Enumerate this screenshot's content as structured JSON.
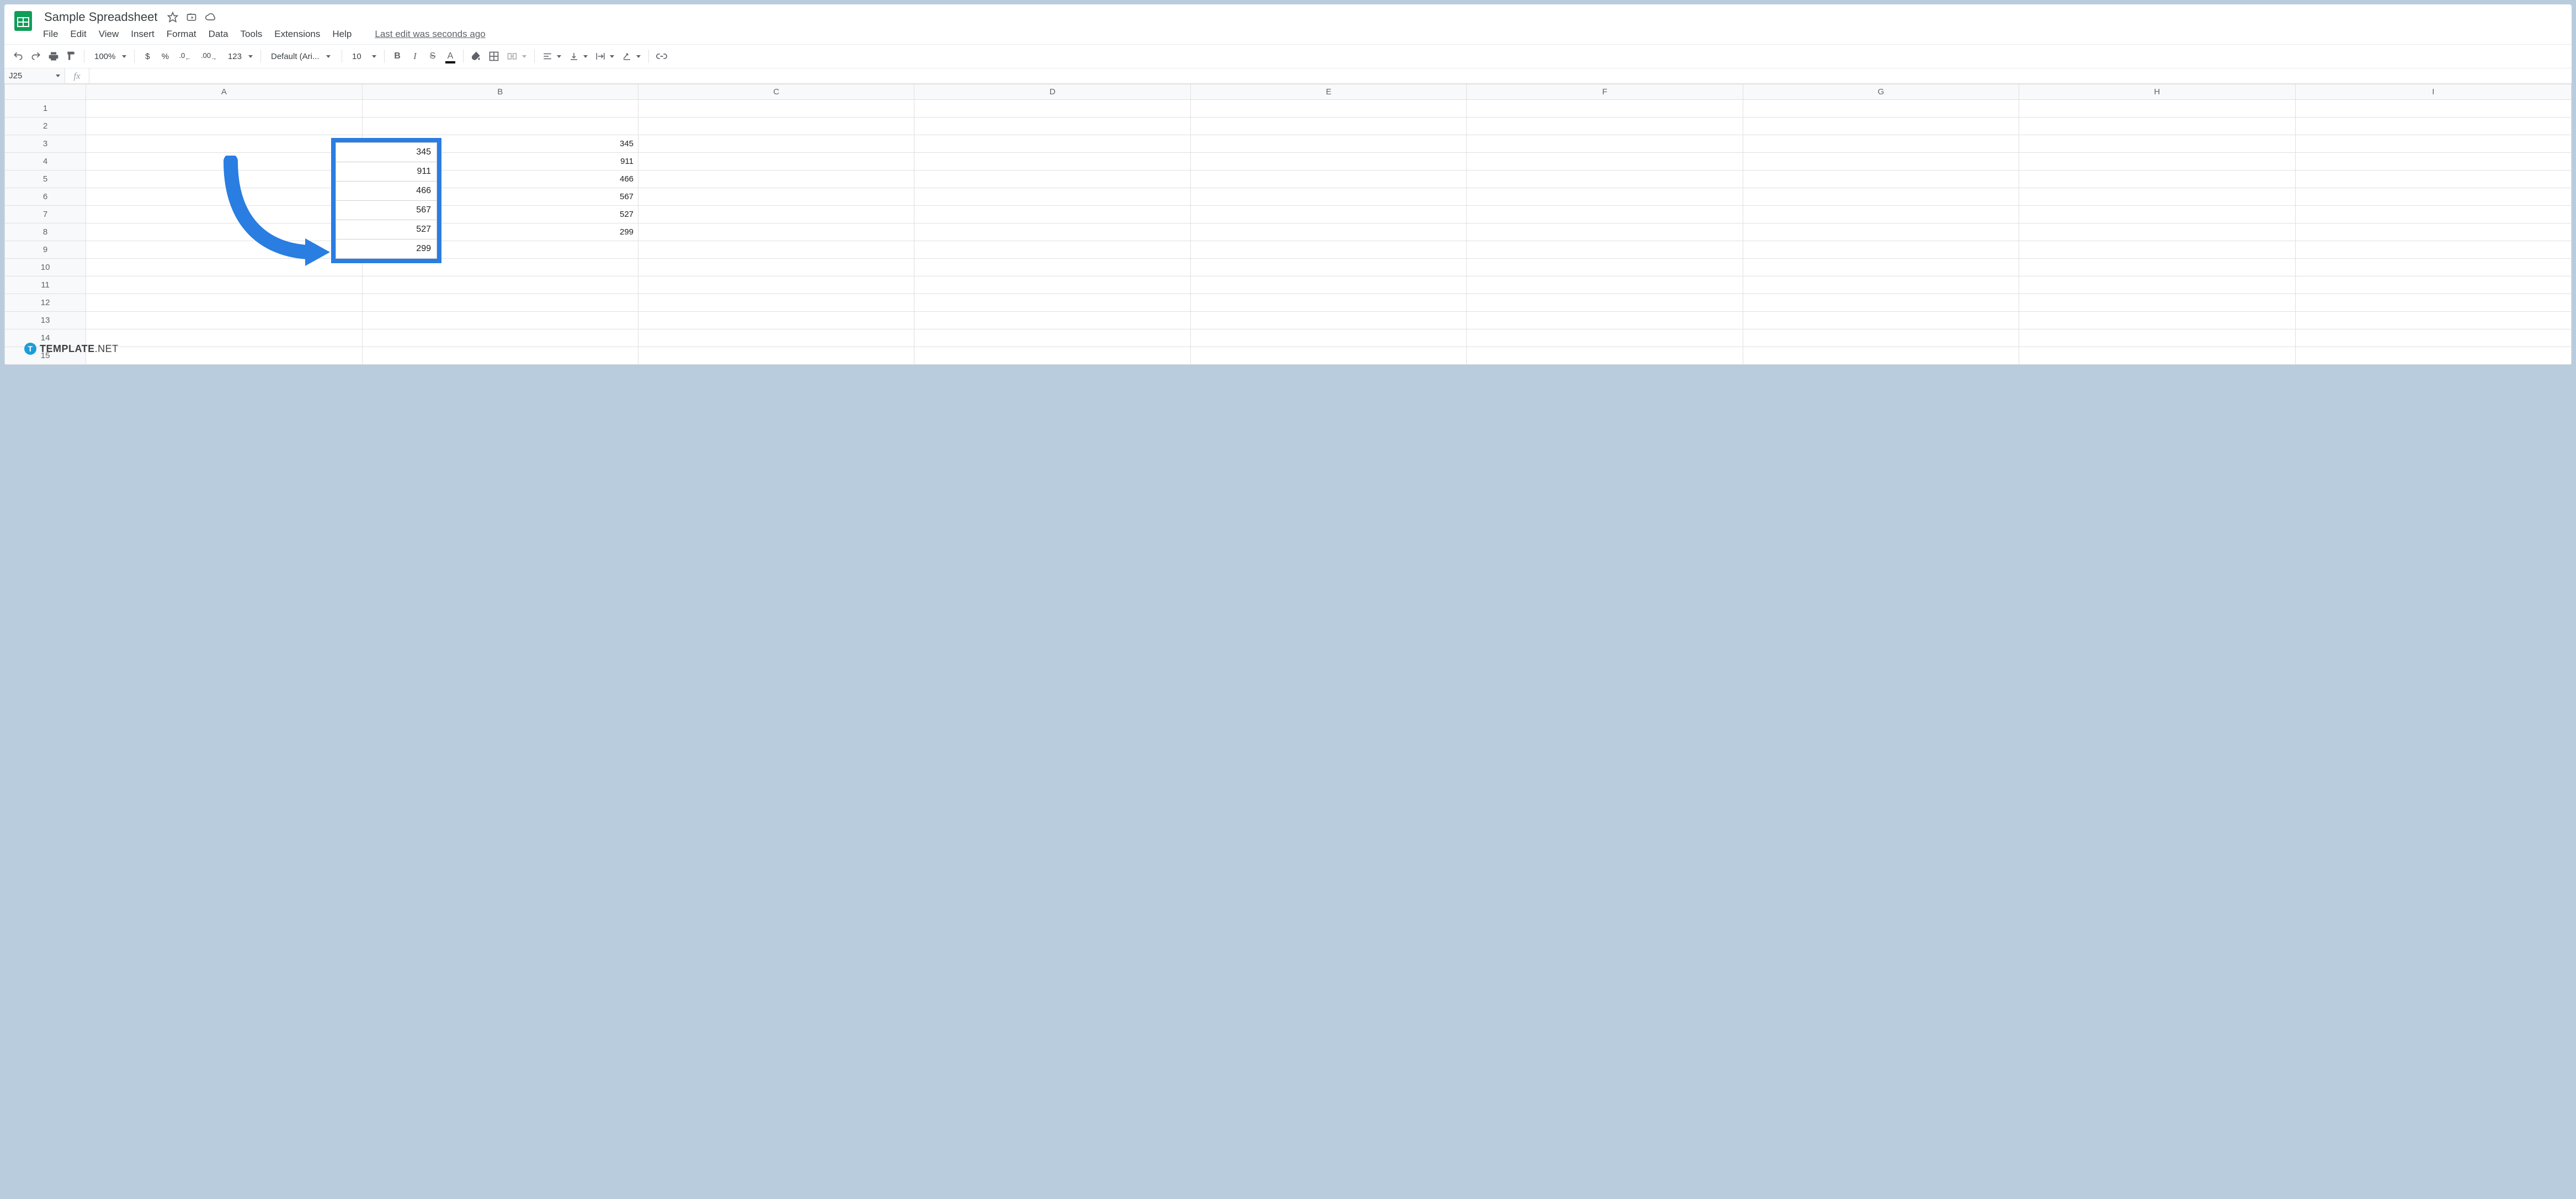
{
  "header": {
    "title": "Sample Spreadsheet",
    "menus": [
      "File",
      "Edit",
      "View",
      "Insert",
      "Format",
      "Data",
      "Tools",
      "Extensions",
      "Help"
    ],
    "last_edit": "Last edit was seconds ago"
  },
  "toolbar": {
    "zoom": "100%",
    "currency": "$",
    "percent": "%",
    "dec_dec": ".0",
    "inc_dec": ".00",
    "more_formats": "123",
    "font": "Default (Ari...",
    "font_size": "10",
    "bold": "B",
    "italic": "I",
    "strike": "S",
    "text_color": "A"
  },
  "name_box": {
    "value": "J25",
    "fx": "fx"
  },
  "grid": {
    "columns": [
      "A",
      "B",
      "C",
      "D",
      "E",
      "F",
      "G",
      "H",
      "I"
    ],
    "rows": 15,
    "cells": {
      "B3": "345",
      "B4": "911",
      "B5": "466",
      "B6": "567",
      "B7": "527",
      "B8": "299"
    }
  },
  "callout": {
    "values": [
      "345",
      "911",
      "466",
      "567",
      "527",
      "299"
    ]
  },
  "watermark": {
    "badge": "T",
    "brand": "TEMPLATE",
    "suffix": ".NET"
  }
}
